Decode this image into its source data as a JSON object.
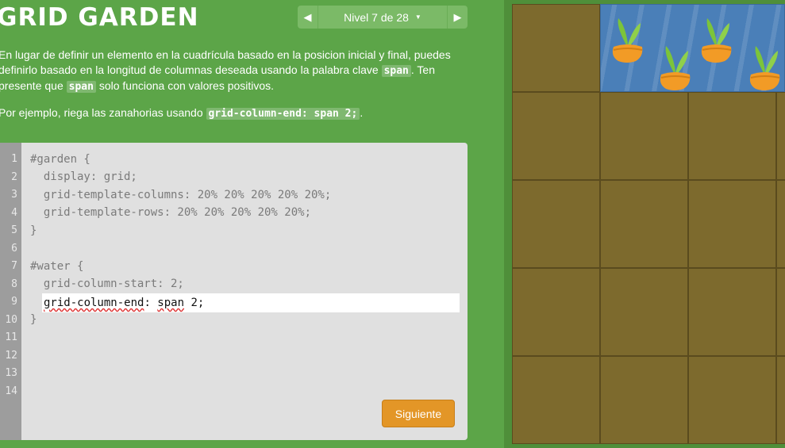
{
  "header": {
    "title": "GRID GARDEN",
    "level_label": "Nivel 7 de 28"
  },
  "instructions": {
    "p1_a": "En lugar de definir un elemento en la cuadrícula basado en la posicion inicial y final, puedes definirlo basado en la longitud de columnas deseada usando la palabra clave ",
    "p1_code": "span",
    "p1_b": ". Ten presente que ",
    "p1_code2": "span",
    "p1_c": " solo funciona con valores positivos.",
    "p2_a": "Por ejemplo, riega las zanahorias usando ",
    "p2_code": "grid-column-end: span 2;",
    "p2_b": "."
  },
  "editor": {
    "line_numbers": [
      "1",
      "2",
      "3",
      "4",
      "5",
      "6",
      "7",
      "8",
      "9",
      "10",
      "11",
      "12",
      "13",
      "14"
    ],
    "lines": [
      "#garden {",
      "  display: grid;",
      "  grid-template-columns: 20% 20% 20% 20% 20%;",
      "  grid-template-rows: 20% 20% 20% 20% 20%;",
      "}",
      "",
      "#water {",
      "  grid-column-start: 2;",
      "",
      "}"
    ],
    "input_value_a": "grid-column-end",
    "input_value_b": ": ",
    "input_value_c": "span",
    "input_value_d": " 2;",
    "next_label": "Siguiente"
  },
  "colors": {
    "background": "#5ca548",
    "accent_button": "#e39627",
    "water": "#4a7fb8",
    "soil": "#7d6a2d"
  }
}
